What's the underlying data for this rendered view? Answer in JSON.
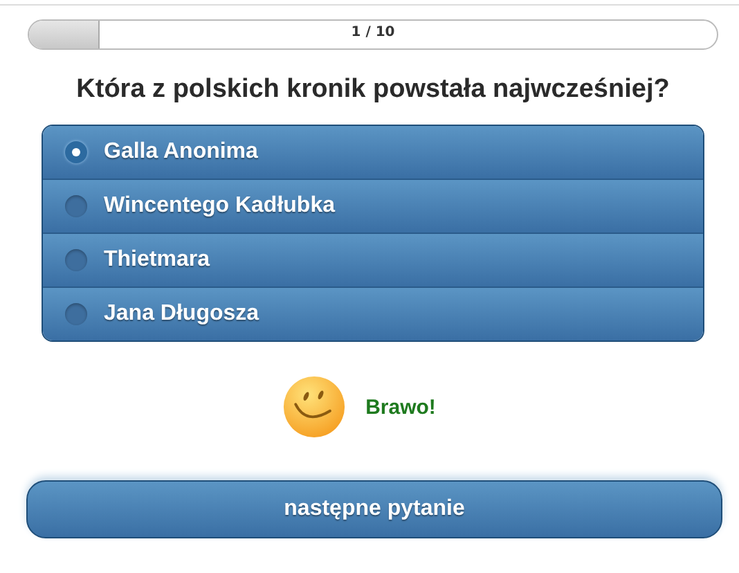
{
  "progress": {
    "level": 0.1,
    "label": "1 / 10"
  },
  "question": "Która z polskich kronik powstała najwcześniej?",
  "answers": [
    {
      "label": "Galla Anonima",
      "selected": true
    },
    {
      "label": "Wincentego Kadłubka",
      "selected": false
    },
    {
      "label": "Thietmara",
      "selected": false
    },
    {
      "label": "Jana Długosza",
      "selected": false
    }
  ],
  "feedback": {
    "text": "Brawo!"
  },
  "next_button": "następne pytanie"
}
